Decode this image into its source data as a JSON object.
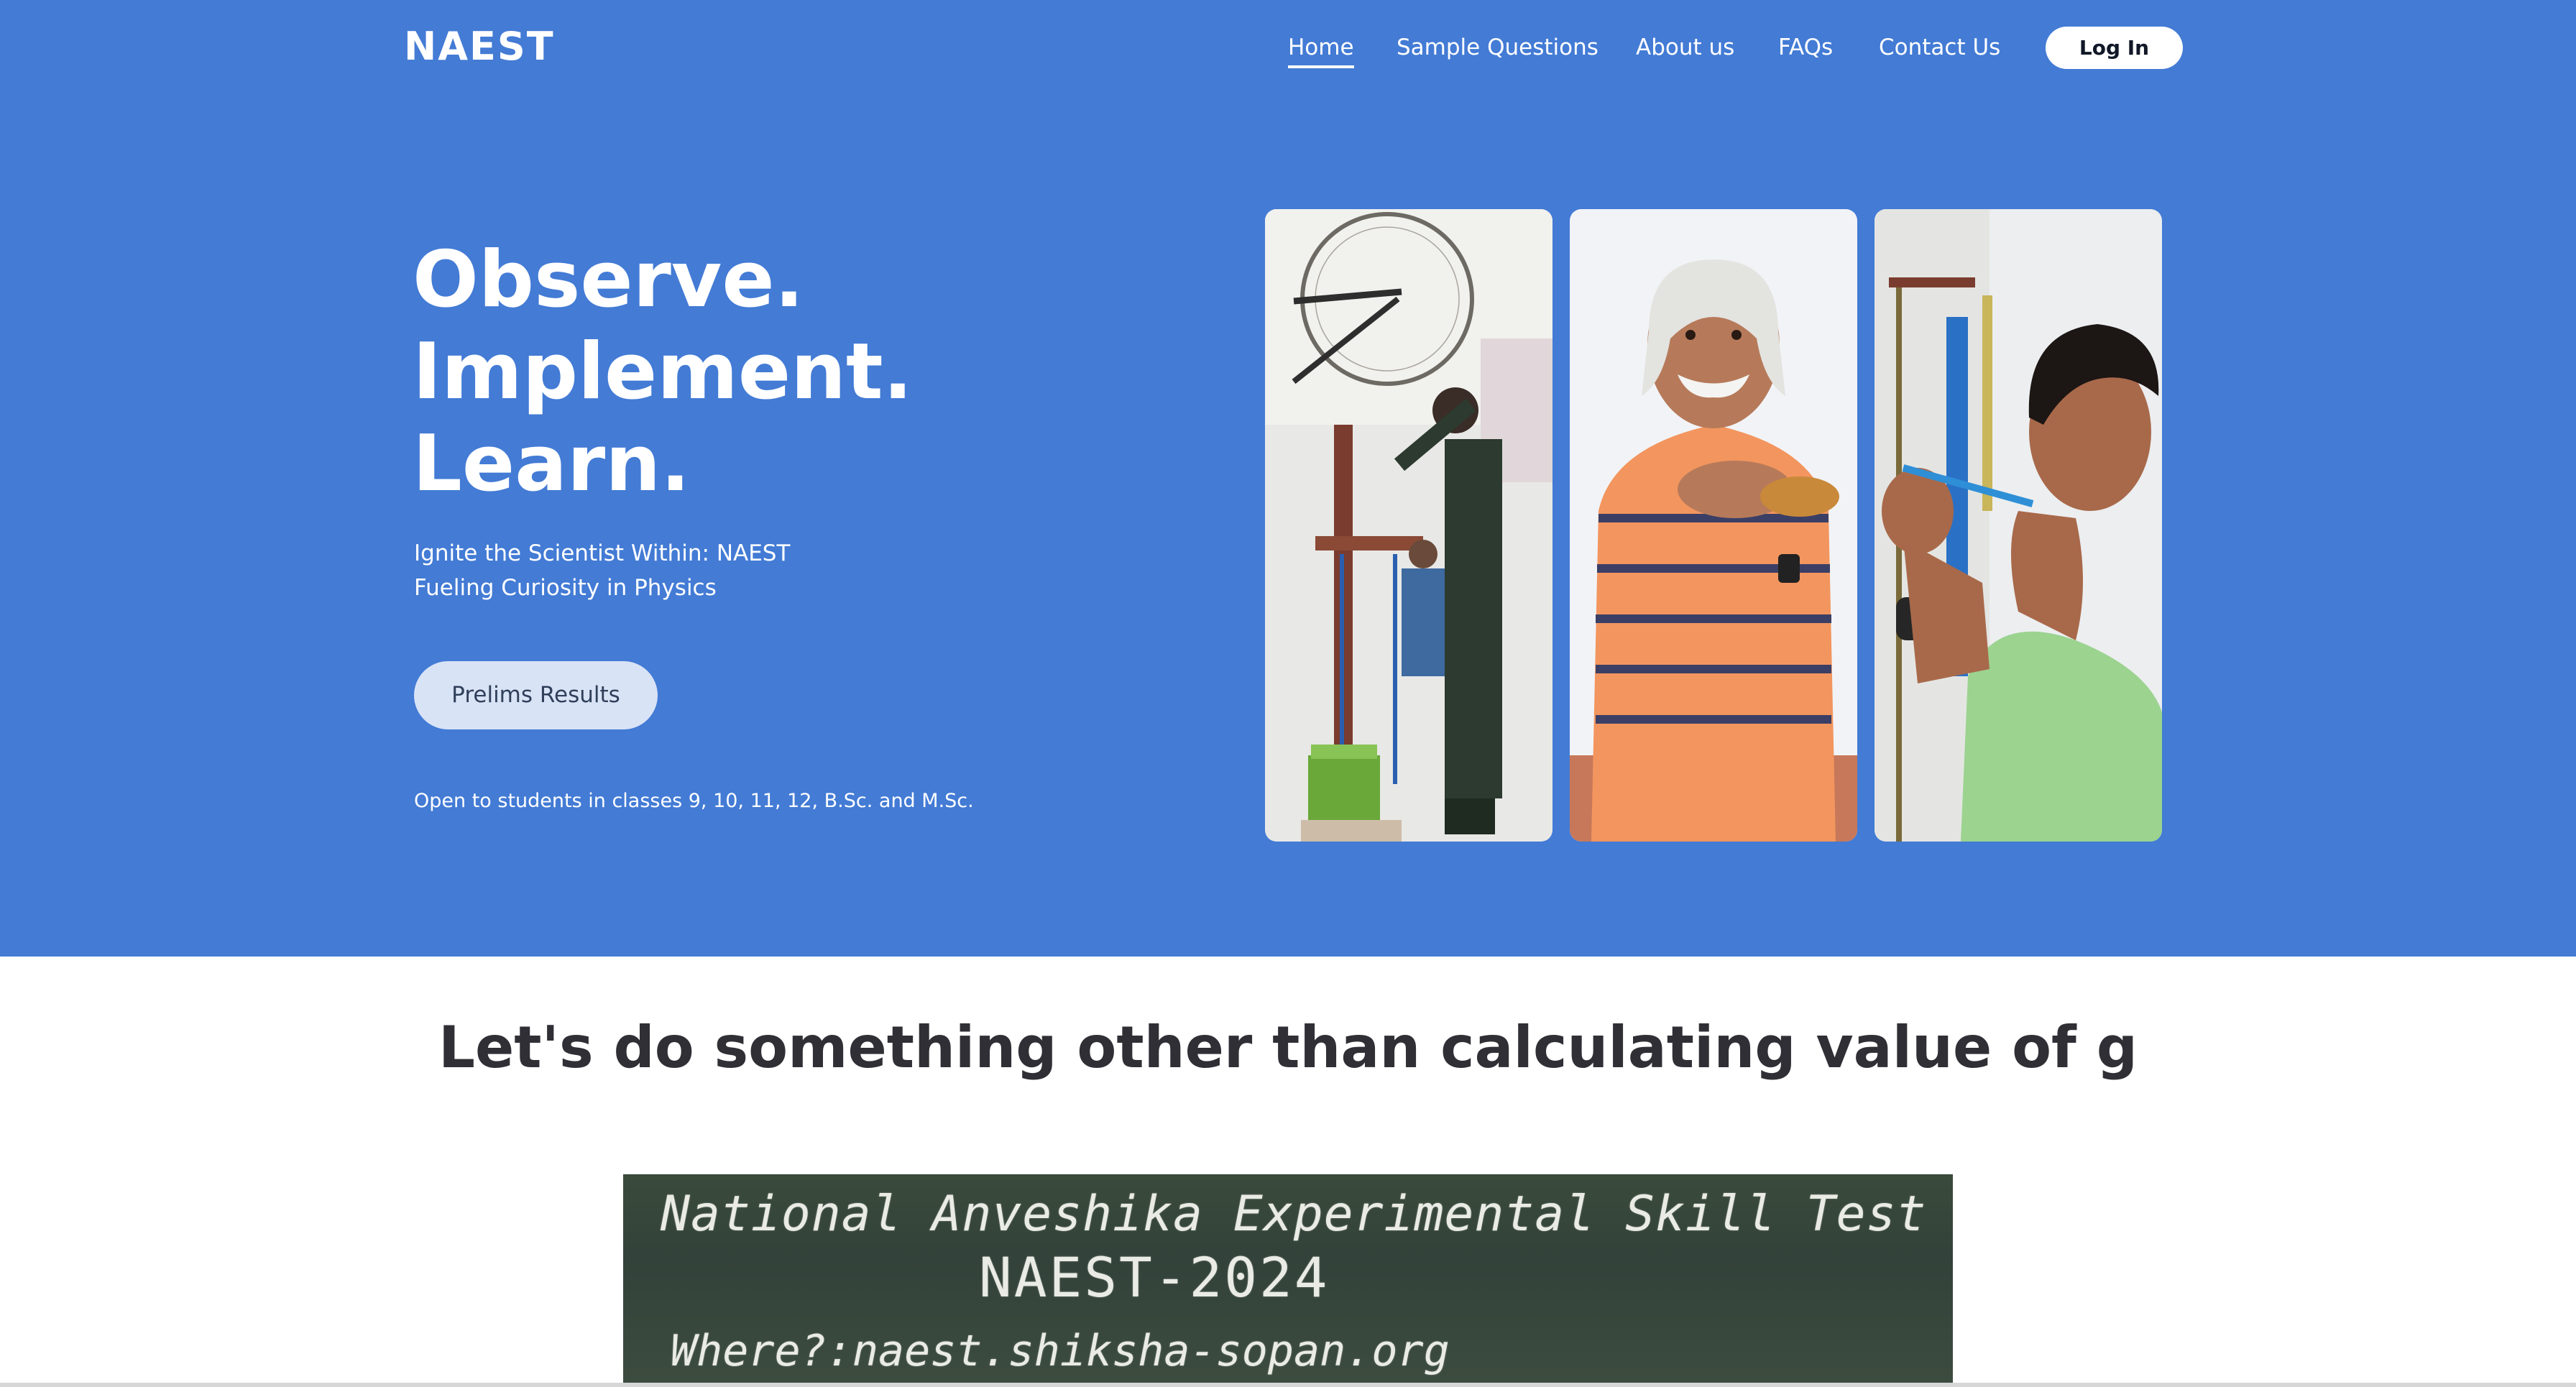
{
  "brand": {
    "logo_text": "NAEST"
  },
  "nav": {
    "items": [
      {
        "label": "Home",
        "active": true
      },
      {
        "label": "Sample Questions",
        "active": false
      },
      {
        "label": "About us",
        "active": false
      },
      {
        "label": "FAQs",
        "active": false
      },
      {
        "label": "Contact Us",
        "active": false
      }
    ],
    "login_label": "Log In"
  },
  "hero": {
    "headline": [
      "Observe.",
      "Implement.",
      "Learn."
    ],
    "subtitle_lines": [
      "Ignite the Scientist Within: NAEST",
      "Fueling Curiosity in Physics"
    ],
    "cta_label": "Prelims Results",
    "eligibility": "Open to students in classes 9, 10, 11, 12, B.Sc. and M.Sc.",
    "photos": [
      "student-experiment-photo",
      "instructor-photo",
      "student-measuring-photo"
    ]
  },
  "section": {
    "title": "Let's do something other than calculating value of g",
    "board_lines": [
      "National Anveshika Experimental Skill Test",
      "NAEST-2024",
      "Where?:naest.shiksha-sopan.org"
    ]
  },
  "colors": {
    "hero_bg": "#437bd5",
    "button_light": "#d9e3f6",
    "title_text": "#2f2f35"
  }
}
